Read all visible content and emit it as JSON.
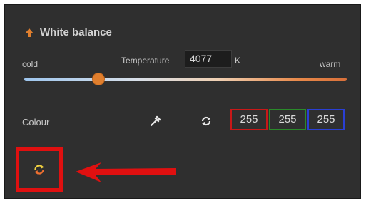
{
  "panel": {
    "title": "White balance",
    "cold_label": "cold",
    "warm_label": "warm",
    "temperature_label": "Temperature",
    "temperature_value": "4077",
    "temperature_unit": "K",
    "slider_level": 0.23
  },
  "colour": {
    "label": "Colour",
    "r": "255",
    "g": "255",
    "b": "255"
  },
  "colors": {
    "panel_bg": "#2f2f2f",
    "accent_orange": "#e07f2e",
    "red": "#e01010",
    "green": "#2a8a2a",
    "blue": "#2a3fd4",
    "highlight": "#e01010"
  },
  "icons": {
    "collapse": "arrow-up-icon",
    "picker": "eyedropper-icon",
    "auto": "auto-cycle-icon",
    "reset": "reset-cycle-icon",
    "annotation": "red-arrow"
  }
}
